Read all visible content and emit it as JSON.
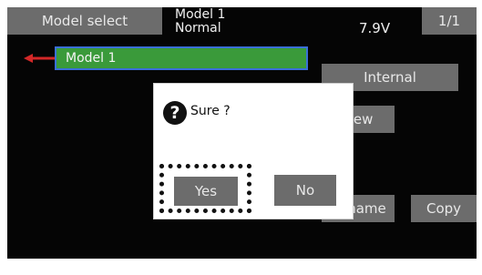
{
  "header": {
    "model_select_label": "Model select",
    "model_name": "Model 1",
    "condition": "Normal",
    "voltage": "7.9V",
    "page_indicator": "1/1"
  },
  "model_list": {
    "items": [
      {
        "label": "Model 1",
        "selected": true
      }
    ]
  },
  "side_buttons": {
    "internal_label": "Internal",
    "new_label": "New",
    "rename_label": "Rename",
    "copy_label": "Copy"
  },
  "dialog": {
    "icon": "question-mark-icon",
    "message": "Sure ?",
    "yes_label": "Yes",
    "no_label": "No"
  },
  "colors": {
    "background": "#050505",
    "button": "#6c6c6c",
    "selection_fill": "#3a9a3a",
    "selection_border": "#3a6fd8",
    "pointer": "#d42828"
  }
}
